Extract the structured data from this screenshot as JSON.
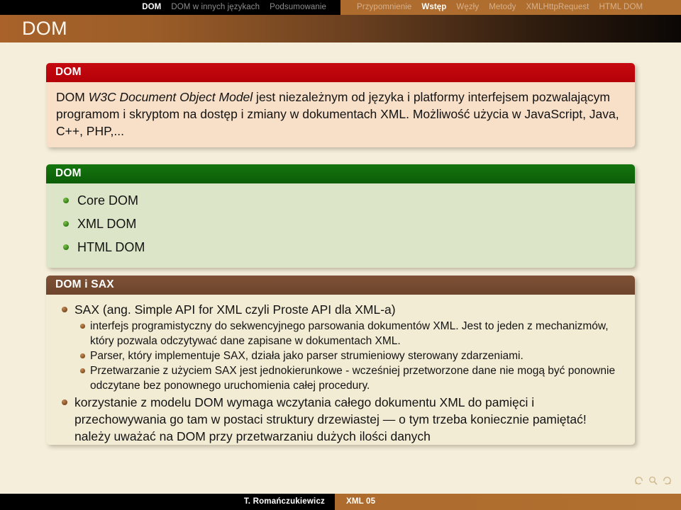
{
  "navbar": {
    "left_section": [
      {
        "label": "DOM",
        "active": true
      },
      {
        "label": "DOM w innych językach",
        "active": false
      },
      {
        "label": "Podsumowanie",
        "active": false
      }
    ],
    "right_section": [
      {
        "label": "Przypomnienie",
        "active": false
      },
      {
        "label": "Wstęp",
        "active": true
      },
      {
        "label": "Węzły",
        "active": false
      },
      {
        "label": "Metody",
        "active": false
      },
      {
        "label": "XMLHttpRequest",
        "active": false
      },
      {
        "label": "HTML DOM",
        "active": false
      }
    ]
  },
  "titlebar": {
    "title": "DOM"
  },
  "blocks": {
    "intro": {
      "title": "DOM",
      "text_prefix": "DOM ",
      "text_emphasis": "W3C Document Object Model",
      "text_rest": " jest niezależnym od języka i platformy interfejsem pozwalającym programom i skryptom na dostęp i zmiany w dokumentach XML. Możliwość użycia w JavaScript, Java, C++, PHP,..."
    },
    "kinds": {
      "title": "DOM",
      "items": [
        "Core DOM",
        "XML DOM",
        "HTML DOM"
      ]
    },
    "domsax": {
      "title": "DOM i SAX",
      "items": [
        {
          "text": "SAX (ang. Simple API for XML czyli Proste API dla XML-a)",
          "subitems": [
            "interfejs programistyczny do sekwencyjnego parsowania dokumentów XML. Jest to jeden z mechanizmów, który pozwala odczytywać dane zapisane w dokumentach XML.",
            "Parser, który implementuje SAX, działa jako parser strumieniowy sterowany zdarzeniami.",
            "Przetwarzanie z użyciem SAX jest jednokierunkowe - wcześniej przetworzone dane nie mogą być ponownie odczytane bez ponownego uruchomienia całej procedury."
          ]
        },
        {
          "text": "korzystanie z modelu DOM wymaga wczytania całego dokumentu XML do pamięci i przechowywania go tam w postaci struktury drzewiastej — o tym trzeba koniecznie pamiętać!",
          "continuation": "należy uważać na DOM przy przetwarzaniu dużych ilości danych",
          "subitems": []
        }
      ]
    }
  },
  "nav_symbols": [
    "previous-slide-icon",
    "search-icon",
    "next-slide-icon"
  ],
  "footer": {
    "author": "T. Romańczukiewicz",
    "course": "XML 05"
  },
  "colors": {
    "background": "#f4eeda",
    "accent_brown": "#ad6b2e",
    "block_red": "#c50a10",
    "block_green": "#14750f",
    "block_brown": "#7d5136",
    "nav_black": "#000000"
  }
}
